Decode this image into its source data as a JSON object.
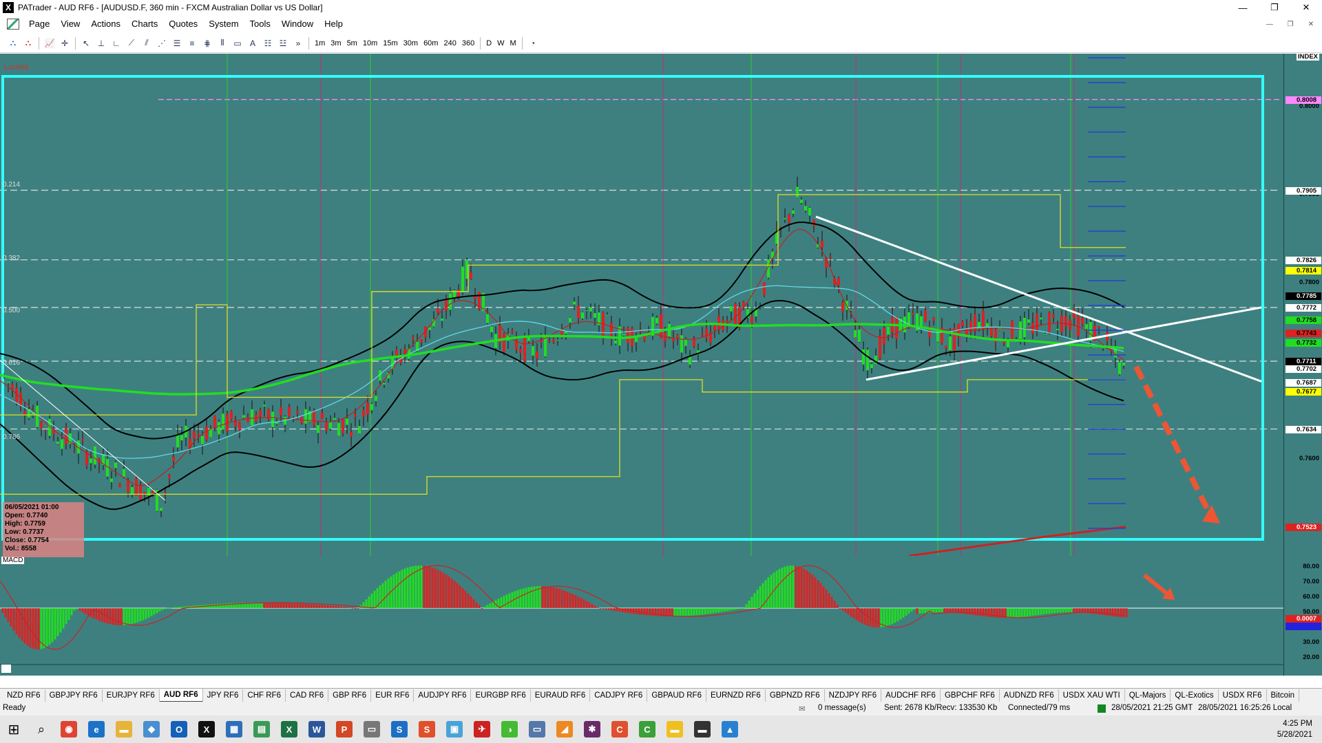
{
  "window": {
    "title": "PATrader - AUD RF6 - [AUDUSD.F, 360 min - FXCM Australian Dollar vs US Dollar]",
    "app_icon": "X"
  },
  "menu": [
    "Page",
    "View",
    "Actions",
    "Charts",
    "Quotes",
    "System",
    "Tools",
    "Window",
    "Help"
  ],
  "timeframes": [
    "1m",
    "3m",
    "5m",
    "10m",
    "15m",
    "30m",
    "60m",
    "240",
    "360",
    "D",
    "W",
    "M"
  ],
  "chart": {
    "locked_label": "Locked",
    "fib_levels": [
      {
        "label": "0.214",
        "price": 0.7905
      },
      {
        "label": "0.382",
        "price": 0.7826
      },
      {
        "label": "0.500",
        "price": 0.7772
      },
      {
        "label": "0.616",
        "price": 0.7711
      },
      {
        "label": "0.786",
        "price": 0.7634
      }
    ],
    "macd_label": "MACD",
    "info_box": {
      "date": "06/05/2021 01:00",
      "open": "Open: 0.7740",
      "high": "High: 0.7759",
      "low": "Low: 0.7737",
      "close": "Close: 0.7754",
      "vol": "Vol.: 8558"
    },
    "price_axis": {
      "top_label": "INDEX",
      "ticks": [
        "0.8000",
        "0.7900",
        "0.7800",
        "0.7700",
        "0.7600"
      ],
      "badges": [
        {
          "value": "0.8008",
          "color": "#ff88ff"
        },
        {
          "value": "0.7905",
          "color": "#ffffff"
        },
        {
          "value": "0.7826",
          "color": "#ffffff"
        },
        {
          "value": "0.7814",
          "color": "#ffff00"
        },
        {
          "value": "0.7785",
          "color": "#000000",
          "text": "#ffffff"
        },
        {
          "value": "0.7772",
          "color": "#ffffff"
        },
        {
          "value": "0.7758",
          "color": "#22dd22"
        },
        {
          "value": "0.7743",
          "color": "#dd2222"
        },
        {
          "value": "0.7732",
          "color": "#22dd22"
        },
        {
          "value": "0.7711",
          "color": "#000000",
          "text": "#ffffff"
        },
        {
          "value": "0.7702",
          "color": "#ffffff"
        },
        {
          "value": "0.7687",
          "color": "#ffffff"
        },
        {
          "value": "0.7677",
          "color": "#ffff00"
        },
        {
          "value": "0.7634",
          "color": "#ffffff"
        },
        {
          "value": "0.7523",
          "color": "#dd2222",
          "text": "#ffffff"
        }
      ],
      "macd_ticks": [
        "80.00",
        "70.00",
        "60.00",
        "50.00",
        "40.00",
        "30.00",
        "20.00"
      ],
      "macd_badges": [
        {
          "value": "0.0007",
          "color": "#dd2222"
        },
        {
          "value": "",
          "color": "#2222dd"
        }
      ]
    }
  },
  "symbol_tabs": [
    "NZD RF6",
    "GBPJPY RF6",
    "EURJPY RF6",
    "AUD RF6",
    "JPY RF6",
    "CHF RF6",
    "CAD RF6",
    "GBP RF6",
    "EUR RF6",
    "AUDJPY RF6",
    "EURGBP RF6",
    "EURAUD RF6",
    "CADJPY RF6",
    "GBPAUD RF6",
    "EURNZD RF6",
    "GBPNZD RF6",
    "NZDJPY RF6",
    "AUDCHF RF6",
    "GBPCHF RF6",
    "AUDNZD RF6",
    "USDX XAU WTI",
    "QL-Majors",
    "QL-Exotics",
    "USDX RF6",
    "Bitcoin"
  ],
  "active_tab": "AUD RF6",
  "status": {
    "ready": "Ready",
    "messages": "0 message(s)",
    "traffic": "Sent: 2678 Kb/Recv: 133530 Kb",
    "connection": "Connected/79 ms",
    "server_time": "28/05/2021 21:25 GMT",
    "local_time": "28/05/2021 16:25:26 Local"
  },
  "taskbar": {
    "time": "4:25 PM",
    "date": "5/28/2021",
    "apps": [
      {
        "name": "chrome-icon",
        "color": "#dd4433",
        "glyph": "◉"
      },
      {
        "name": "edge-icon",
        "color": "#1a73c8",
        "glyph": "e"
      },
      {
        "name": "folder-icon",
        "color": "#e8b33a",
        "glyph": "▬"
      },
      {
        "name": "tool-icon",
        "color": "#4a8fd0",
        "glyph": "◆"
      },
      {
        "name": "outlook-icon",
        "color": "#1560b8",
        "glyph": "O"
      },
      {
        "name": "patrader-icon",
        "color": "#111111",
        "glyph": "X"
      },
      {
        "name": "calculator-icon",
        "color": "#2e6fb8",
        "glyph": "▦"
      },
      {
        "name": "chart-app-icon",
        "color": "#3a9a55",
        "glyph": "▤"
      },
      {
        "name": "excel-icon",
        "color": "#1e7145",
        "glyph": "X"
      },
      {
        "name": "word-icon",
        "color": "#2b579a",
        "glyph": "W"
      },
      {
        "name": "powerpoint-icon",
        "color": "#d24726",
        "glyph": "P"
      },
      {
        "name": "app-icon-gray",
        "color": "#777777",
        "glyph": "▭"
      },
      {
        "name": "snagit-icon",
        "color": "#1d6fc6",
        "glyph": "S"
      },
      {
        "name": "snagit-editor-icon",
        "color": "#e0502a",
        "glyph": "S"
      },
      {
        "name": "remote-icon",
        "color": "#4aa3d8",
        "glyph": "▣"
      },
      {
        "name": "bird-icon",
        "color": "#cc2222",
        "glyph": "✈"
      },
      {
        "name": "green-app-icon",
        "color": "#44bb33",
        "glyph": "◑"
      },
      {
        "name": "monitor-icon",
        "color": "#5577aa",
        "glyph": "▭"
      },
      {
        "name": "orange-app-icon",
        "color": "#ee8822",
        "glyph": "◢"
      },
      {
        "name": "slack-icon",
        "color": "#6a2a6a",
        "glyph": "✱"
      },
      {
        "name": "c-app-icon",
        "color": "#e05030",
        "glyph": "C"
      },
      {
        "name": "camtasia-icon",
        "color": "#3aa03a",
        "glyph": "C"
      },
      {
        "name": "notes-icon",
        "color": "#f0c020",
        "glyph": "▬"
      },
      {
        "name": "terminal-icon",
        "color": "#333333",
        "glyph": "▬"
      },
      {
        "name": "photos-icon",
        "color": "#2a80d0",
        "glyph": "▲"
      }
    ]
  }
}
